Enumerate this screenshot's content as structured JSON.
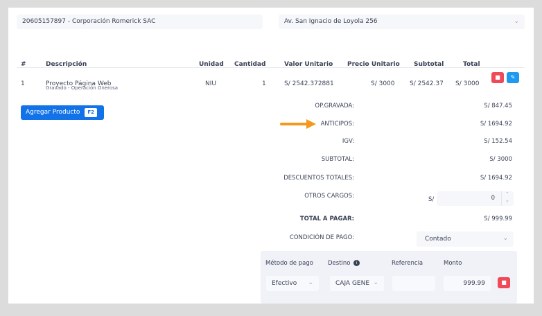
{
  "header": {
    "client": "20605157897 - Corporación Romerick SAC",
    "address": "Av. San Ignacio de Loyola 256"
  },
  "table": {
    "columns": [
      "#",
      "Descripción",
      "Unidad",
      "Cantidad",
      "Valor Unitario",
      "Precio Unitario",
      "Subtotal",
      "Total"
    ],
    "rows": [
      {
        "num": "1",
        "description": "Proyecto Página Web",
        "sub_description": "Gravado - Operación Onerosa",
        "unit": "NIU",
        "quantity": "1",
        "valor_unitario": "S/ 2542.372881",
        "precio_unitario": "S/ 3000",
        "subtotal": "S/ 2542.37",
        "total": "S/ 3000"
      }
    ]
  },
  "add_product": {
    "label": "Agregar Producto",
    "shortcut": "F2"
  },
  "summary": {
    "op_gravada": {
      "label": "OP.GRAVADA:",
      "value": "S/ 847.45"
    },
    "anticipos": {
      "label": "ANTICIPOS:",
      "value": "S/ 1694.92"
    },
    "igv": {
      "label": "IGV:",
      "value": "S/ 152.54"
    },
    "subtotal": {
      "label": "SUBTOTAL:",
      "value": "S/ 3000"
    },
    "descuentos": {
      "label": "DESCUENTOS TOTALES:",
      "value": "S/ 1694.92"
    },
    "otros_cargos": {
      "label": "OTROS CARGOS:",
      "currency": "S/",
      "value": "0"
    },
    "total_pagar": {
      "label": "TOTAL A PAGAR:",
      "value": "S/ 999.99"
    },
    "condicion_pago": {
      "label": "CONDICIÓN DE PAGO:",
      "value": "Contado"
    }
  },
  "payment": {
    "headers": {
      "method": "Método de pago",
      "destination": "Destino",
      "reference": "Referencia",
      "amount": "Monto"
    },
    "row": {
      "method": "Efectivo",
      "destination": "CAJA GENE",
      "reference": "",
      "amount": "999.99"
    }
  },
  "colors": {
    "primary": "#1273e8",
    "danger": "#ef4a5a",
    "info": "#1e9bf0",
    "arrow": "#f39a1e"
  }
}
